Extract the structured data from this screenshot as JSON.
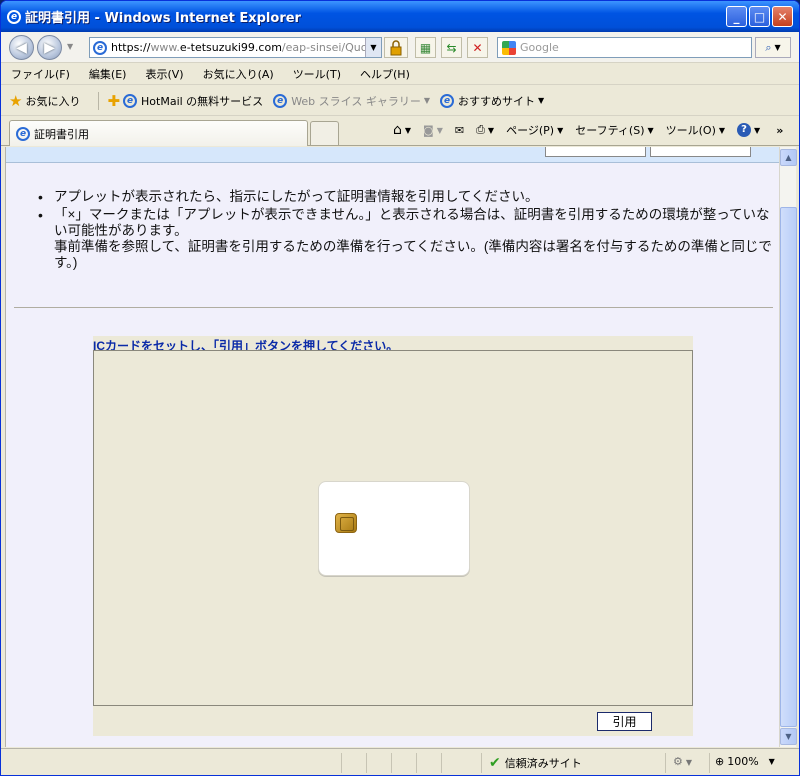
{
  "window": {
    "title": "証明書引用 - Windows Internet Explorer",
    "minimize": "_",
    "maximize": "□",
    "close": "✕"
  },
  "address_bar": {
    "proto": "https://",
    "grey_prefix": "www.",
    "domain": "e-tetsuzuki99.com",
    "path": "/eap-sinsei/Quot",
    "search_placeholder": "Google"
  },
  "menu": [
    "ファイル(F)",
    "編集(E)",
    "表示(V)",
    "お気に入り(A)",
    "ツール(T)",
    "ヘルプ(H)"
  ],
  "favorites_bar": {
    "favorites_label": "お気に入り",
    "items": [
      {
        "label": "HotMail の無料サービス"
      },
      {
        "label": "Web スライス ギャラリー"
      },
      {
        "label": "おすすめサイト"
      }
    ]
  },
  "tab": {
    "title": "証明書引用"
  },
  "command_bar": {
    "page": "ページ(P)",
    "safety": "セーフティ(S)",
    "tools": "ツール(O)"
  },
  "content": {
    "note1": "アプレットが表示されたら、指示にしたがって証明書情報を引用してください。",
    "note2_line1": "「×」マークまたは「アプレットが表示できません。」と表示される場合は、証明書を引用するための環境が整っていない可能性があります。",
    "note2_line2": "事前準備を参照して、証明書を引用するための準備を行ってください。(準備内容は署名を付与するための準備と同じです。)"
  },
  "applet": {
    "hint": "ICカードをセットし、「引用」ボタンを押してください。",
    "apply_button": "引用"
  },
  "status_bar": {
    "zone": "信頼済みサイト",
    "zoom": "100%"
  }
}
